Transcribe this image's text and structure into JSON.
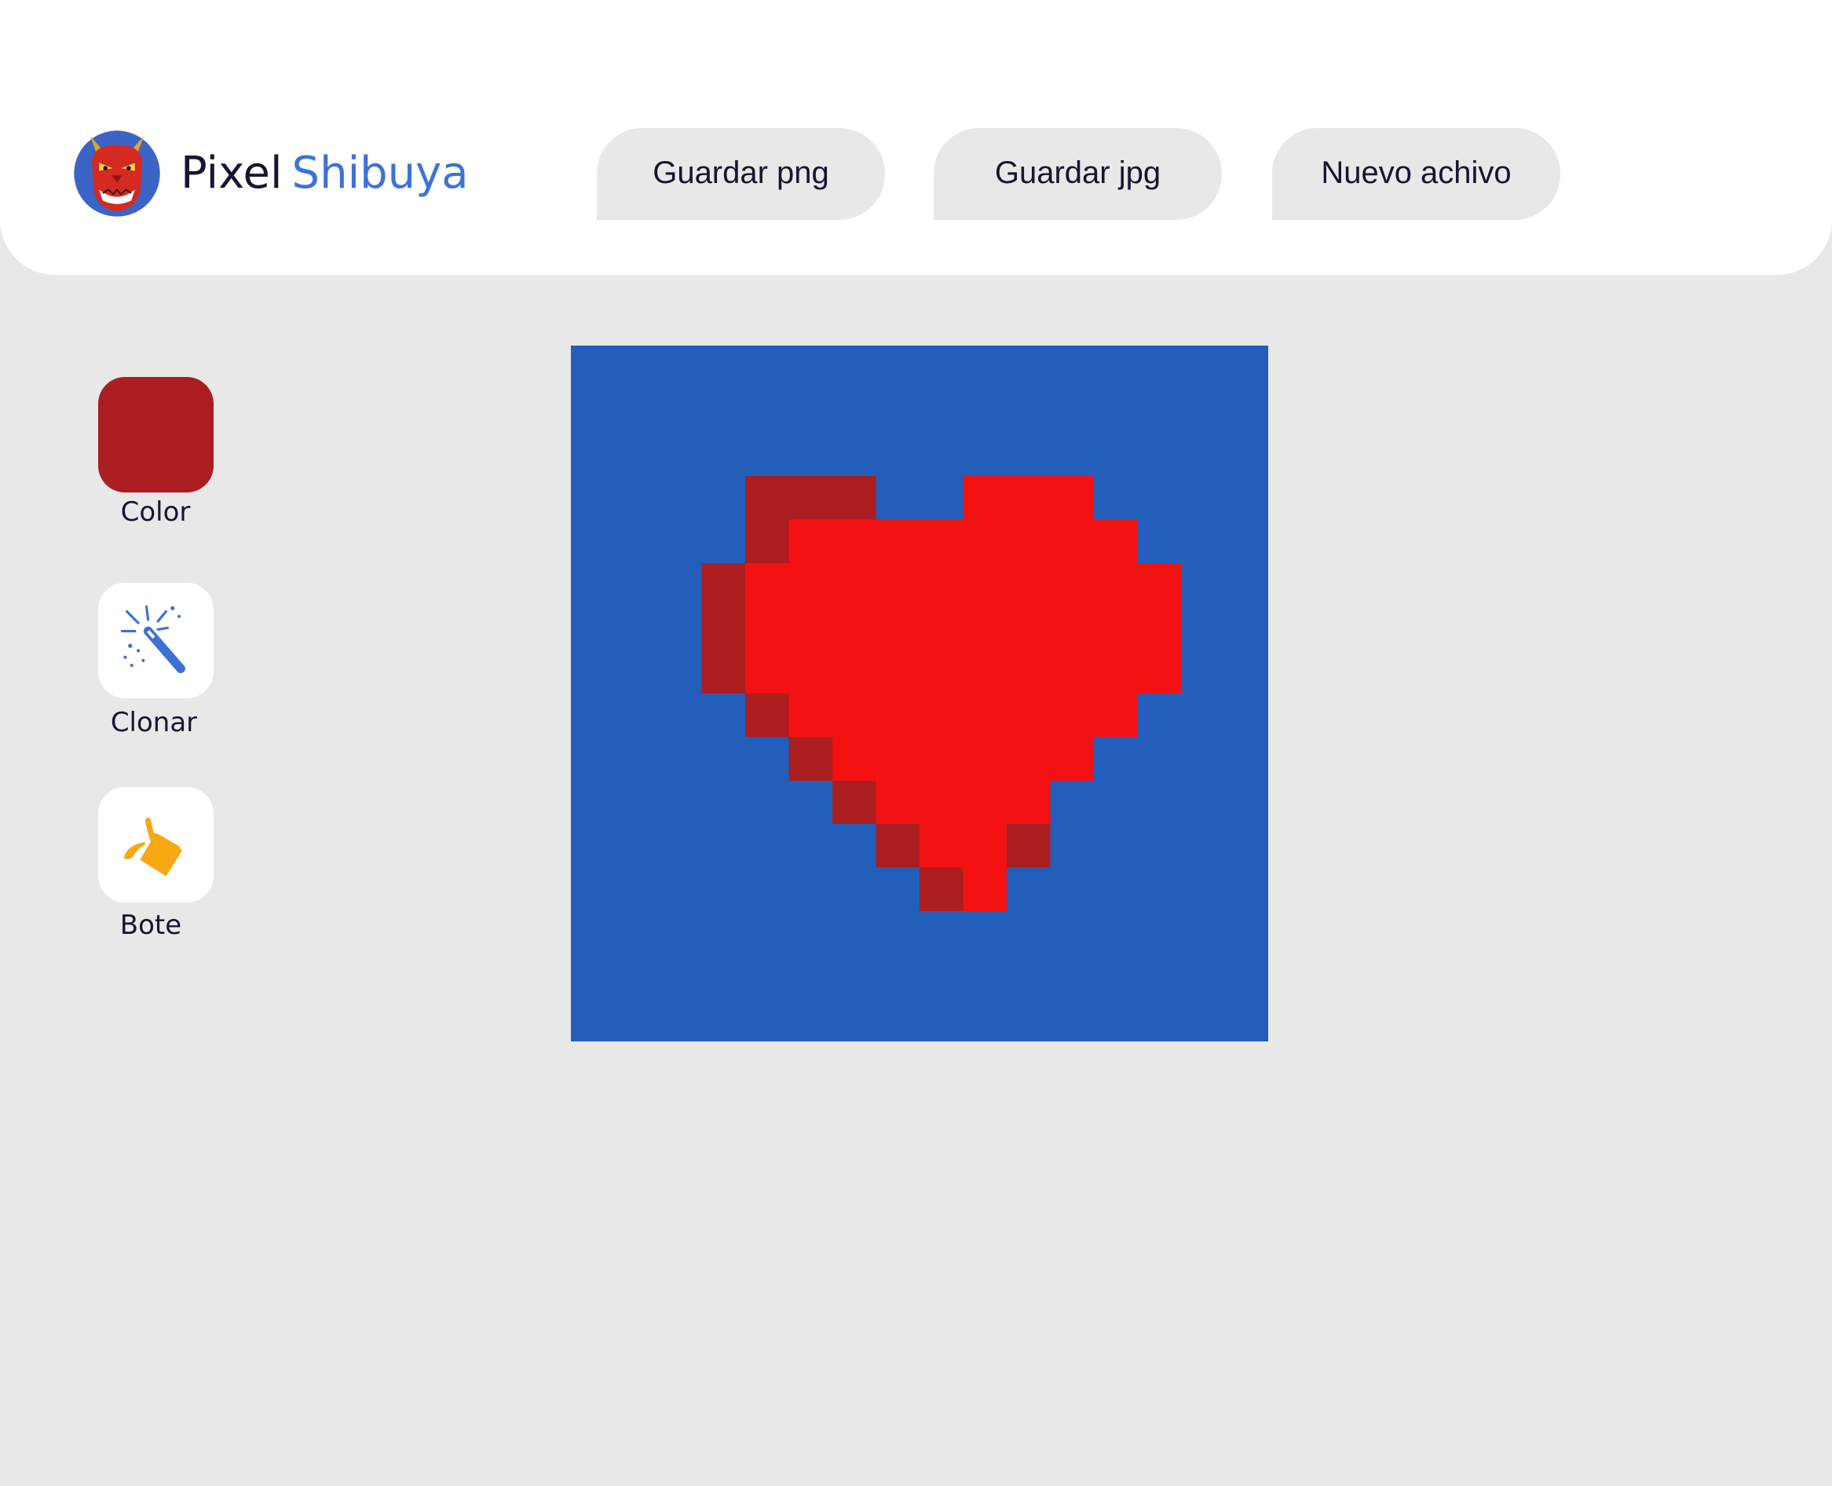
{
  "app": {
    "title_part1": "Pixel",
    "title_part2": "Shibuya"
  },
  "header": {
    "buttons": [
      {
        "label": "Guardar png"
      },
      {
        "label": "Guardar jpg"
      },
      {
        "label": "Nuevo achivo"
      }
    ]
  },
  "tools": {
    "color": {
      "label": "Color",
      "swatch": "#ab1e20"
    },
    "clone": {
      "label": "Clonar",
      "icon": "magic-wand-icon"
    },
    "bucket": {
      "label": "Bote",
      "icon": "paint-bucket-icon"
    }
  },
  "canvas": {
    "grid_size": 16,
    "colors": {
      "background": "#235ebb",
      "bright_red": "#f31112",
      "dark_red": "#ab1e20"
    },
    "pixel_rows": [
      "0000000000000000",
      "0000000000000000",
      "0000000000000000",
      "0000222001110000",
      "0000211111111000",
      "0002111111111100",
      "0002111111111100",
      "0002111111111100",
      "0000211111111000",
      "0000021111110000",
      "0000002111100000",
      "0000000211200000",
      "0000000021000000",
      "0000000000000000",
      "0000000000000000",
      "0000000000000000"
    ]
  }
}
